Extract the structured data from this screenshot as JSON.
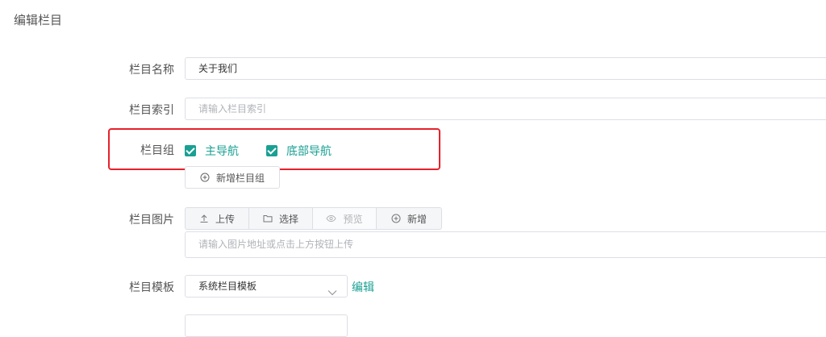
{
  "page_title": "编辑栏目",
  "form": {
    "name": {
      "label": "栏目名称",
      "value": "关于我们"
    },
    "index": {
      "label": "栏目索引",
      "placeholder": "请输入栏目索引"
    },
    "group": {
      "label": "栏目组",
      "options": [
        {
          "label": "主导航",
          "checked": true
        },
        {
          "label": "底部导航",
          "checked": true
        }
      ],
      "add_button": "新增栏目组"
    },
    "image": {
      "label": "栏目图片",
      "buttons": {
        "upload": "上传",
        "select": "选择",
        "preview": "预览",
        "add": "新增"
      },
      "placeholder": "请输入图片地址或点击上方按钮上传"
    },
    "template": {
      "label": "栏目模板",
      "value": "系统栏目模板",
      "edit_link": "编辑"
    }
  },
  "colors": {
    "accent": "#1aa093",
    "highlight": "#e8212b",
    "border": "#dcdfe6"
  }
}
